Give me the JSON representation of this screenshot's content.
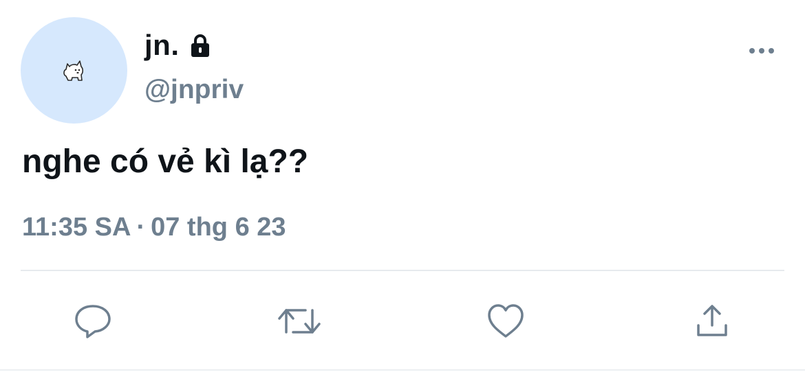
{
  "author": {
    "display_name": "jn.",
    "handle": "@jnpriv",
    "avatar_icon": "dog-avatar-icon",
    "protected_icon": "lock-icon"
  },
  "tweet": {
    "text": "nghe có vẻ kì lạ??",
    "time": "11:35 SA",
    "separator": "·",
    "date": "07 thg 6 23"
  },
  "actions": {
    "more_icon": "more-icon",
    "reply_icon": "reply-icon",
    "retweet_icon": "retweet-icon",
    "like_icon": "heart-icon",
    "share_icon": "share-icon"
  },
  "colors": {
    "text_primary": "#0f1419",
    "text_secondary": "#6e7f8f",
    "avatar_bg": "#d6e8fd",
    "divider": "#e6eaee"
  }
}
